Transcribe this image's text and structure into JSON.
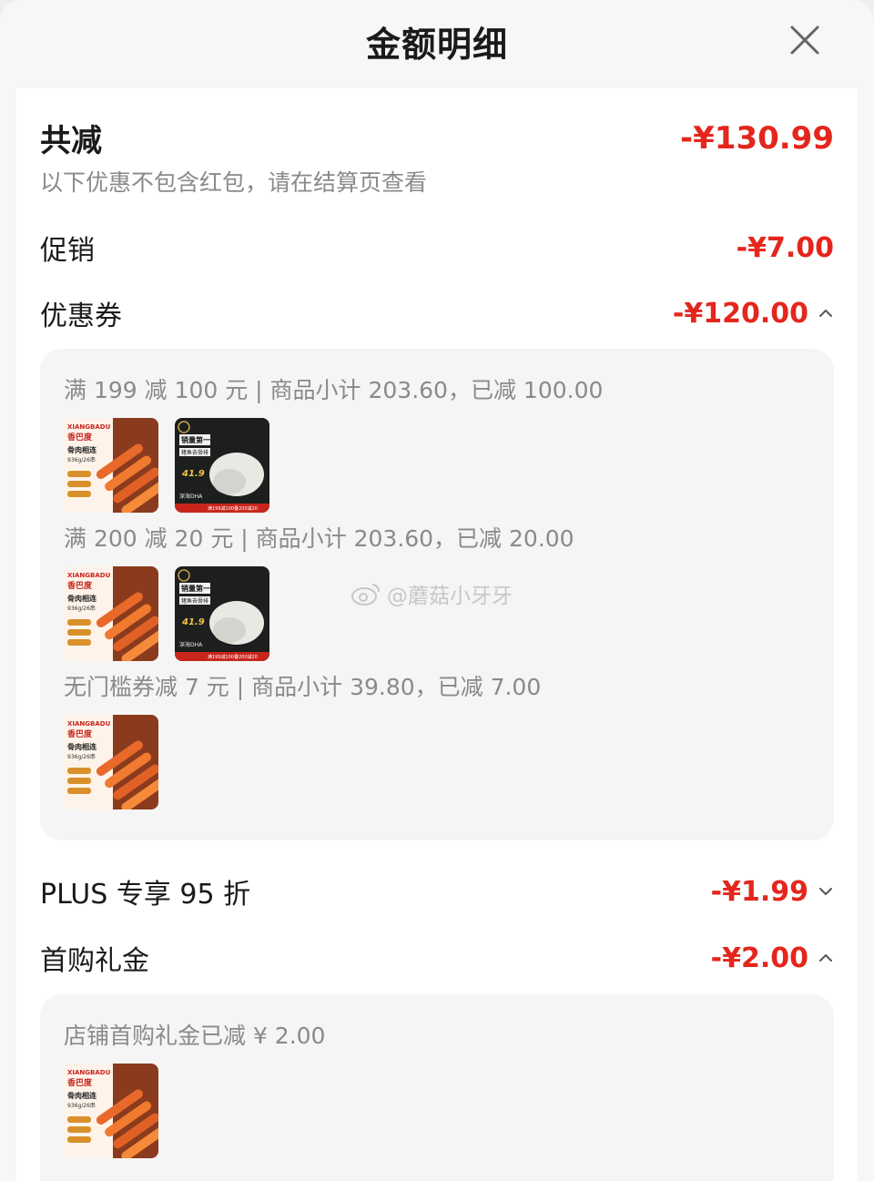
{
  "header": {
    "title": "金额明细",
    "close_icon": "close-icon"
  },
  "summary": {
    "total_label": "共减",
    "total_amount": "-¥130.99",
    "note": "以下优惠不包含红包，请在结算页查看"
  },
  "rows": {
    "promo": {
      "label": "促销",
      "amount": "-¥7.00"
    },
    "coupon": {
      "label": "优惠券",
      "amount": "-¥120.00",
      "chevron": "chevron-up-icon"
    },
    "plus": {
      "label": "PLUS 专享 95 折",
      "amount": "-¥1.99",
      "chevron": "chevron-down-icon"
    },
    "first_gift": {
      "label": "首购礼金",
      "amount": "-¥2.00",
      "chevron": "chevron-up-icon"
    }
  },
  "coupon_details": [
    {
      "text": "满 199 减 100 元 | 商品小计 203.60，已减 100.00",
      "products": [
        "skewer",
        "fish"
      ]
    },
    {
      "text": "满 200 减 20 元 | 商品小计 203.60，已减 20.00",
      "products": [
        "skewer",
        "fish"
      ]
    },
    {
      "text": "无门槛券减 7 元 | 商品小计 39.80，已减 7.00",
      "products": [
        "skewer"
      ]
    }
  ],
  "gift_details": [
    {
      "text": "店铺首购礼金已减 ¥ 2.00",
      "products": [
        "skewer"
      ]
    }
  ],
  "product_labels": {
    "skewer": {
      "brand_en": "XIANGBADU",
      "brand": "香巴度",
      "name": "骨肉相连",
      "spec": "936g/26串"
    },
    "fish": {
      "headline": "销量第一",
      "name": "猪鱼去骨排",
      "price": "41.9",
      "tag": "深海DHA",
      "promo": "满199减100叠200减20"
    }
  },
  "watermark": "@蘑菇小牙牙",
  "colors": {
    "accent": "#e4261d",
    "muted": "#8a8a8a",
    "text": "#1a1a1a",
    "panel": "#f5f5f5"
  }
}
